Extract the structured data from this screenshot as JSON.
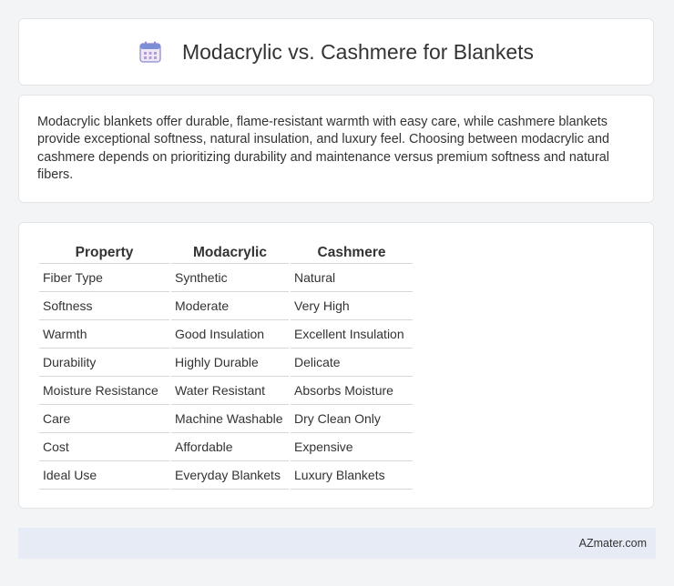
{
  "header": {
    "title": "Modacrylic vs. Cashmere for Blankets",
    "icon": "calendar-icon"
  },
  "intro": {
    "text": "Modacrylic blankets offer durable, flame-resistant warmth with easy care, while cashmere blankets provide exceptional softness, natural insulation, and luxury feel. Choosing between modacrylic and cashmere depends on prioritizing durability and maintenance versus premium softness and natural fibers."
  },
  "table": {
    "headers": [
      "Property",
      "Modacrylic",
      "Cashmere"
    ],
    "rows": [
      [
        "Fiber Type",
        "Synthetic",
        "Natural"
      ],
      [
        "Softness",
        "Moderate",
        "Very High"
      ],
      [
        "Warmth",
        "Good Insulation",
        "Excellent Insulation"
      ],
      [
        "Durability",
        "Highly Durable",
        "Delicate"
      ],
      [
        "Moisture Resistance",
        "Water Resistant",
        "Absorbs Moisture"
      ],
      [
        "Care",
        "Machine Washable",
        "Dry Clean Only"
      ],
      [
        "Cost",
        "Affordable",
        "Expensive"
      ],
      [
        "Ideal Use",
        "Everyday Blankets",
        "Luxury Blankets"
      ]
    ]
  },
  "footer": {
    "brand": "AZmater.com"
  }
}
